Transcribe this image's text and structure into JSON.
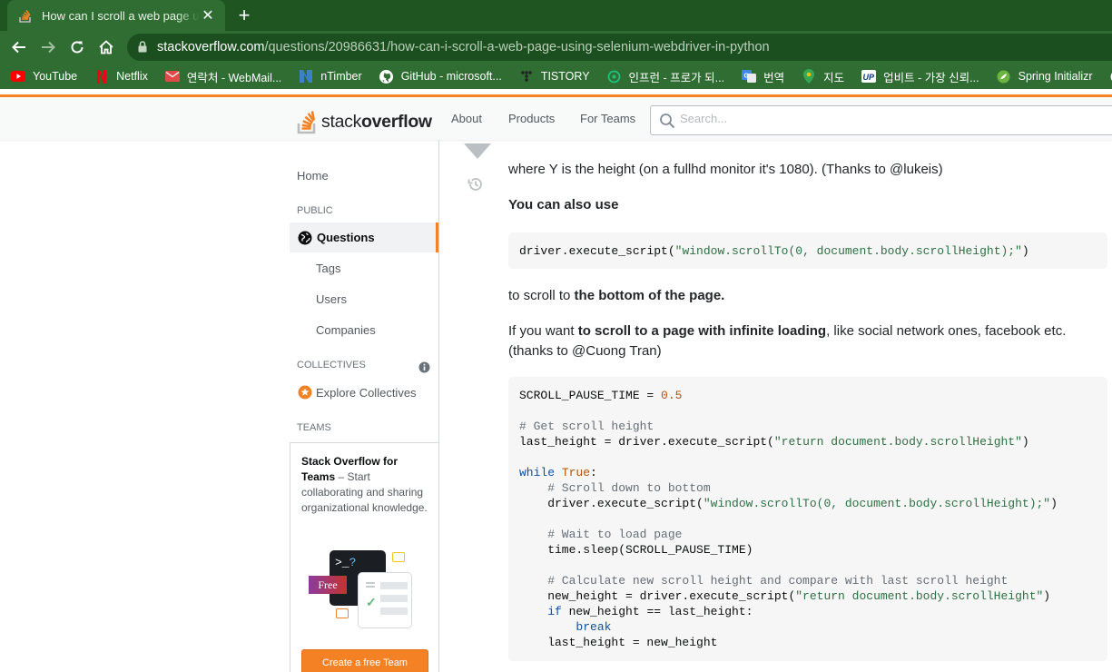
{
  "browser": {
    "tab_title": "How can I scroll a web page using selenium webdriver in python",
    "new_tab_symbol": "+",
    "close_symbol": "✕",
    "url_host": "stackoverflow.com",
    "url_path": "/questions/20986631/how-can-i-scroll-a-web-page-using-selenium-webdriver-in-python",
    "bookmarks": [
      {
        "label": "YouTube",
        "icon": "youtube-icon",
        "color": "#ff0000"
      },
      {
        "label": "Netflix",
        "icon": "netflix-icon",
        "color": "#e50914"
      },
      {
        "label": "연락처 - WebMail...",
        "icon": "mail-icon",
        "color": "#e04a4a"
      },
      {
        "label": "nTimber",
        "icon": "ntimber-icon",
        "color": "#2b6cb0"
      },
      {
        "label": "GitHub - microsoft...",
        "icon": "github-icon",
        "color": "#ffffff"
      },
      {
        "label": "TISTORY",
        "icon": "tistory-icon",
        "color": "#222222"
      },
      {
        "label": "인프런 - 프로가 되...",
        "icon": "inflearn-icon",
        "color": "#1dc078"
      },
      {
        "label": "번역",
        "icon": "translate-icon",
        "color": "#4285f4"
      },
      {
        "label": "지도",
        "icon": "map-pin-icon",
        "color": "#34a853"
      },
      {
        "label": "업비트 - 가장 신뢰...",
        "icon": "upbit-icon",
        "color": "#093687"
      },
      {
        "label": "Spring Initializr",
        "icon": "spring-icon",
        "color": "#6db33f"
      },
      {
        "label": "G",
        "icon": "google-icon",
        "color": "#ffffff"
      }
    ]
  },
  "so": {
    "logo_stack": "stack",
    "logo_overflow": "overflow",
    "nav_about": "About",
    "nav_products": "Products",
    "nav_teams": "For Teams",
    "search_placeholder": "Search...",
    "accent": "#f48225"
  },
  "sidebar": {
    "home": "Home",
    "public_heading": "PUBLIC",
    "questions": "Questions",
    "tags": "Tags",
    "users": "Users",
    "companies": "Companies",
    "collectives_heading": "COLLECTIVES",
    "explore_collectives": "Explore Collectives",
    "teams_heading": "TEAMS",
    "teams_title": "Stack Overflow for Teams",
    "teams_desc": " – Start collaborating and sharing organizational knowledge.",
    "free_badge": "Free",
    "create_team": "Create a free Team"
  },
  "post": {
    "p1": "where Y is the height (on a fullhd monitor it's 1080). (Thanks to @lukeis)",
    "p2": "You can also use",
    "code1": {
      "pre": "driver.execute_script(",
      "str": "\"window.scrollTo(0, document.body.scrollHeight);\"",
      "post": ")"
    },
    "p3_pre": "to scroll to ",
    "p3_bold": "the bottom of the page.",
    "p4_pre": "If you want ",
    "p4_bold": "to scroll to a page with infinite loading",
    "p4_post": ", like social network ones, facebook etc.",
    "p4_line2": "(thanks to @Cuong Tran)",
    "code2": {
      "l1a": "SCROLL_PAUSE_TIME = ",
      "l1b": "0.5",
      "l2": "# Get scroll height",
      "l3a": "last_height = driver.execute_script(",
      "l3b": "\"return document.body.scrollHeight\"",
      "l3c": ")",
      "l4a": "while",
      "l4b": " ",
      "l4c": "True",
      "l4d": ":",
      "l5": "    # Scroll down to bottom",
      "l6a": "    driver.execute_script(",
      "l6b": "\"window.scrollTo(0, document.body.scrollHeight);\"",
      "l6c": ")",
      "l7": "    # Wait to load page",
      "l8": "    time.sleep(SCROLL_PAUSE_TIME)",
      "l9": "    # Calculate new scroll height and compare with last scroll height",
      "l10a": "    new_height = driver.execute_script(",
      "l10b": "\"return document.body.scrollHeight\"",
      "l10c": ")",
      "l11a": "    ",
      "l11b": "if",
      "l11c": " new_height == last_height:",
      "l12a": "        ",
      "l12b": "break",
      "l13": "    last_height = new_height"
    }
  }
}
